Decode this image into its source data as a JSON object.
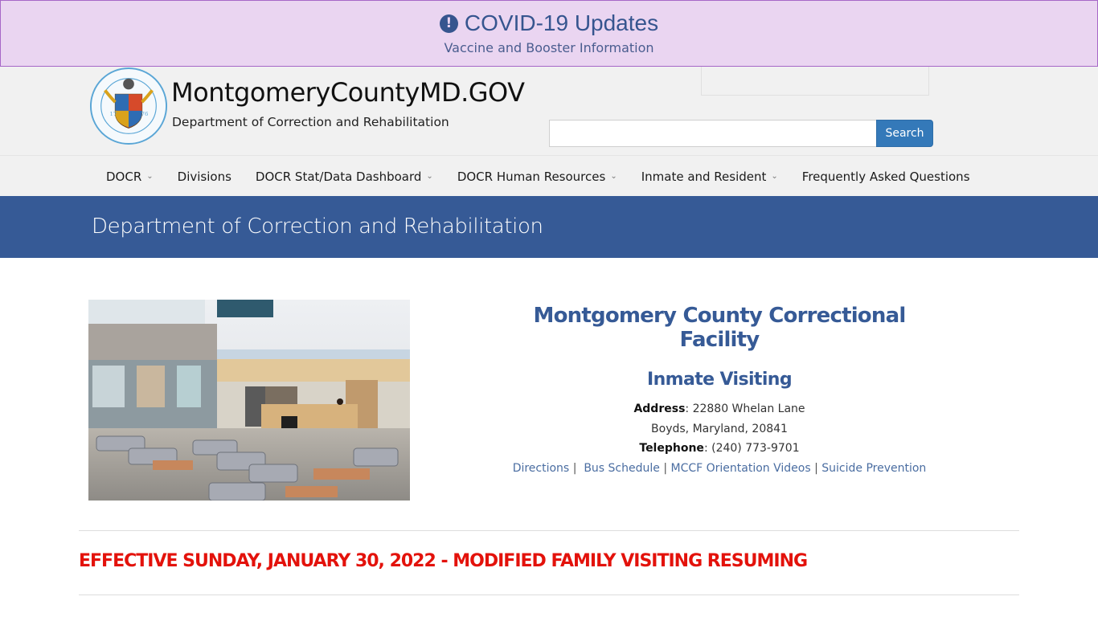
{
  "covid_banner": {
    "icon": "exclamation-circle-icon",
    "title": "COVID-19 Updates",
    "subtitle": "Vaccine and Booster Information"
  },
  "header": {
    "seal": "montgomery-county-seal",
    "site_title": "MontgomeryCountyMD.GOV",
    "department": "Department of Correction and Rehabilitation",
    "search": {
      "value": "",
      "placeholder": "",
      "button_label": "Search"
    }
  },
  "nav": {
    "items": [
      {
        "label": "DOCR",
        "has_dropdown": true
      },
      {
        "label": "Divisions",
        "has_dropdown": false
      },
      {
        "label": "DOCR Stat/Data Dashboard",
        "has_dropdown": true
      },
      {
        "label": "DOCR Human Resources",
        "has_dropdown": true
      },
      {
        "label": "Inmate and Resident",
        "has_dropdown": true
      },
      {
        "label": "Frequently Asked Questions",
        "has_dropdown": false
      }
    ],
    "dropdown_glyph": "⌄"
  },
  "band": {
    "title": "Department of Correction and Rehabilitation"
  },
  "main": {
    "photo_alt": "Correctional facility visiting lobby",
    "facility_title": "Montgomery County Correctional Facility",
    "section_title": "Inmate Visiting",
    "address_label": "Address",
    "address_line1": ": 22880 Whelan Lane",
    "address_line2": "Boyds, Maryland, 20841",
    "telephone_label": "Telephone",
    "telephone_value": ": (240) 773-9701",
    "links": [
      {
        "label": "Directions"
      },
      {
        "label": "Bus Schedule"
      },
      {
        "label": "MCCF Orientation Videos"
      },
      {
        "label": "Suicide Prevention"
      }
    ],
    "link_separator": "|"
  },
  "notice": {
    "text": "EFFECTIVE SUNDAY, JANUARY 30, 2022 - MODIFIED FAMILY VISITING RESUMING",
    "color": "#e3120b"
  },
  "colors": {
    "brand_blue": "#365a96",
    "banner_bg": "#ead5f1",
    "search_button": "#3479b9"
  }
}
